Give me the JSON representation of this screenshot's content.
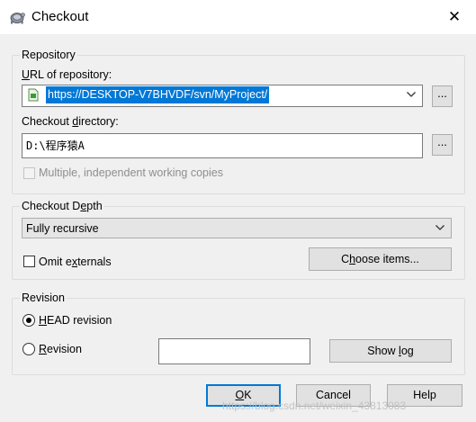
{
  "window": {
    "title": "Checkout",
    "close_glyph": "✕"
  },
  "repository": {
    "group_label": "Repository",
    "url_label_u": "U",
    "url_label_rest": "RL of repository:",
    "url_value": "https://DESKTOP-V7BHVDF/svn/MyProject/",
    "browse_label": "...",
    "dir_label_pre": "Checkout ",
    "dir_label_u": "d",
    "dir_label_post": "irectory:",
    "dir_value": "D:\\程序猿A",
    "dir_browse_label": "...",
    "multiple_label": "Multiple, independent working copies"
  },
  "depth": {
    "group_label_pre": "Checkout D",
    "group_label_u": "e",
    "group_label_post": "pth",
    "selected": "Fully recursive",
    "omit_pre": "Omit e",
    "omit_u": "x",
    "omit_post": "ternals",
    "choose_pre": "C",
    "choose_u": "h",
    "choose_post": "oose items..."
  },
  "revision": {
    "group_label": "Revision",
    "head_u": "H",
    "head_rest": "EAD revision",
    "head_checked": true,
    "rev_u": "R",
    "rev_rest": "evision",
    "rev_value": "",
    "showlog_pre": "Show ",
    "showlog_u": "l",
    "showlog_post": "og"
  },
  "buttons": {
    "ok_u": "O",
    "ok_rest": "K",
    "cancel": "Cancel",
    "help": "Help"
  },
  "watermark": "https://blog.csdn.net/weixin_43813083",
  "colors": {
    "selection": "#0078d7",
    "ok_border": "#0078d7"
  }
}
